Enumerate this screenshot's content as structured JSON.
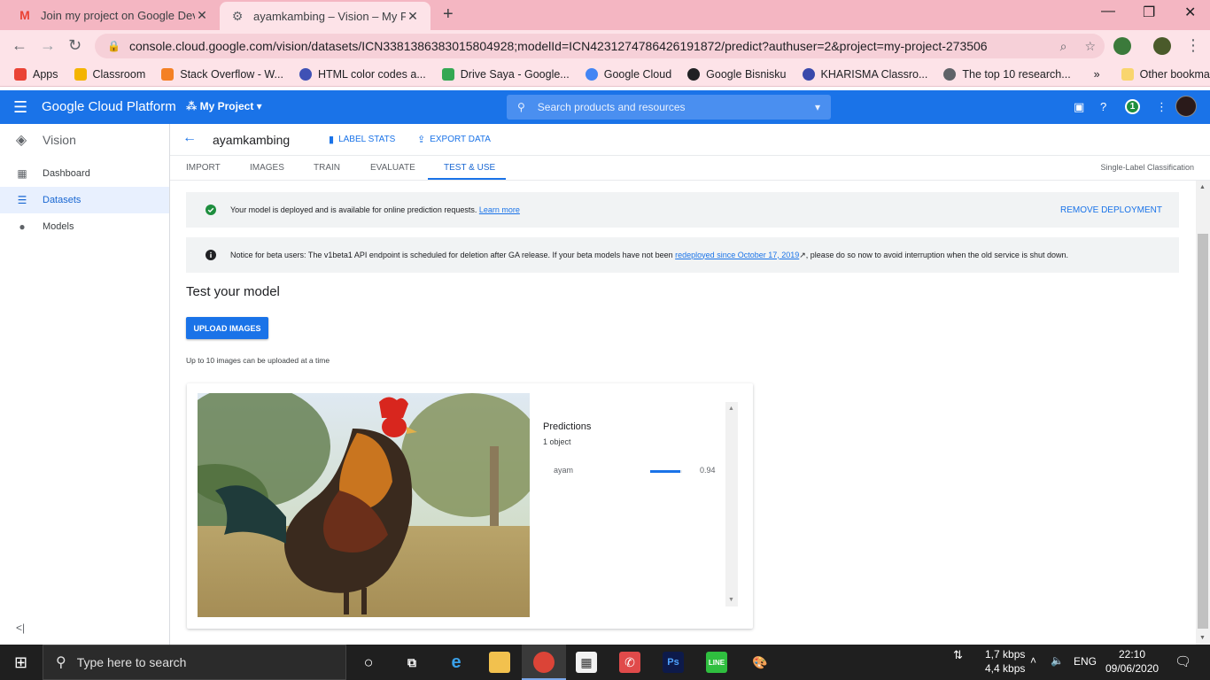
{
  "browser": {
    "tabs": [
      {
        "title": "Join my project on Google Devel",
        "icon": "gmail-icon"
      },
      {
        "title": "ayamkambing – Vision – My Proj",
        "icon": "gcp-icon"
      }
    ],
    "url": "console.cloud.google.com/vision/datasets/ICN3381386383015804928;modelId=ICN4231274786426191872/predict?authuser=2&project=my-project-273506",
    "bookmarks": [
      {
        "label": "Apps",
        "color": "#ea4335"
      },
      {
        "label": "Classroom",
        "color": "#f4b400"
      },
      {
        "label": "Stack Overflow - W...",
        "color": "#f48024"
      },
      {
        "label": "HTML color codes a...",
        "color": "#3f51b5"
      },
      {
        "label": "Drive Saya - Google...",
        "color": "#34a853"
      },
      {
        "label": "Google Cloud",
        "color": "#4285f4"
      },
      {
        "label": "Google Bisnisku",
        "color": "#202124"
      },
      {
        "label": "KHARISMA Classro...",
        "color": "#3949ab"
      },
      {
        "label": "The top 10 research...",
        "color": "#5f6368"
      }
    ],
    "more_bookmarks": "»",
    "other_bookmarks": "Other bookmarks"
  },
  "gcp": {
    "brand": "Google Cloud Platform",
    "project": "My Project",
    "search_placeholder": "Search products and resources",
    "notification_count": "1",
    "accent": "#1a73e8"
  },
  "sidebar": {
    "product": "Vision",
    "items": [
      {
        "label": "Dashboard",
        "icon": "dashboard-icon"
      },
      {
        "label": "Datasets",
        "icon": "list-icon"
      },
      {
        "label": "Models",
        "icon": "bulb-icon"
      }
    ],
    "collapse": "<|"
  },
  "dataset": {
    "name": "ayamkambing",
    "label_stats": "LABEL STATS",
    "export_data": "EXPORT DATA",
    "tabs": [
      "IMPORT",
      "IMAGES",
      "TRAIN",
      "EVALUATE",
      "TEST & USE"
    ],
    "active_tab": "TEST & USE",
    "classification": "Single-Label Classification"
  },
  "deployed": {
    "text": "Your model is deployed and is available for online prediction requests.",
    "link": "Learn more",
    "action": "REMOVE DEPLOYMENT"
  },
  "beta_notice": {
    "before": "Notice for beta users: The v1beta1 API endpoint is scheduled for deletion after GA release. If your beta models have not been ",
    "link": "redeployed since October 17, 2019",
    "after": ", please do so now to avoid interruption when the old service is shut down."
  },
  "test": {
    "heading": "Test your model",
    "upload_label": "UPLOAD IMAGES",
    "hint": "Up to 10 images can be uploaded at a time"
  },
  "predictions": {
    "title": "Predictions",
    "count": "1 object",
    "items": [
      {
        "label": "ayam",
        "score": "0.94",
        "fraction": 0.94
      }
    ]
  },
  "taskbar": {
    "search_placeholder": "Type here to search",
    "net_down": "1,7 kbps",
    "net_up": "4,4 kbps",
    "lang": "ENG",
    "time": "22:10",
    "date": "09/06/2020"
  }
}
